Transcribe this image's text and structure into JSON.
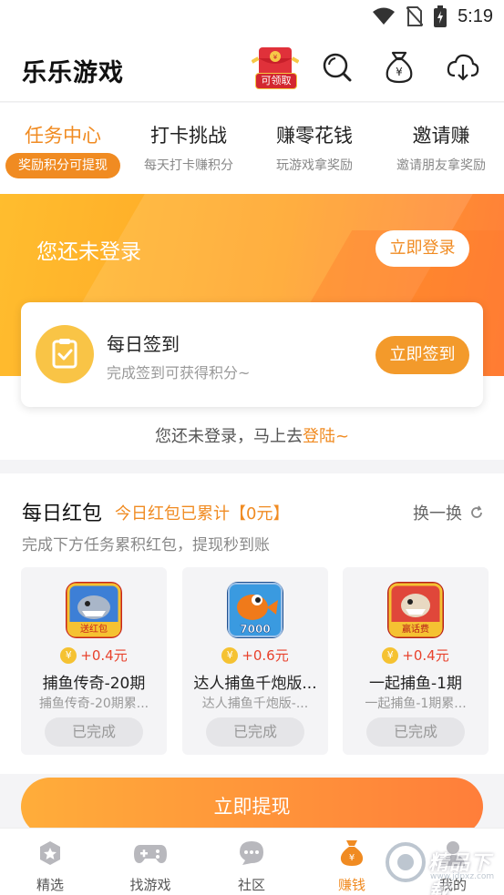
{
  "status_bar": {
    "time": "5:19"
  },
  "header": {
    "title": "乐乐游戏",
    "redpack_label": "可领取"
  },
  "tabs": [
    {
      "title": "任务中心",
      "subtitle": "奖励积分可提现",
      "active": true
    },
    {
      "title": "打卡挑战",
      "subtitle": "每天打卡赚积分",
      "active": false
    },
    {
      "title": "赚零花钱",
      "subtitle": "玩游戏拿奖励",
      "active": false
    },
    {
      "title": "邀请赚",
      "subtitle": "邀请朋友拿奖励",
      "active": false
    }
  ],
  "hero": {
    "not_logged_in": "您还未登录",
    "login_button": "立即登录",
    "sign_card": {
      "title": "每日签到",
      "subtitle": "完成签到可获得积分~",
      "button": "立即签到"
    },
    "notice_prefix": "您还未登录，马上去",
    "notice_link": "登陆~"
  },
  "daily": {
    "title": "每日红包",
    "total": "今日红包已累计【0元】",
    "swap": "换一换",
    "subtitle": "完成下方任务累积红包，提现秒到账",
    "cards": [
      {
        "reward": "+0.4元",
        "name": "捕鱼传奇-20期",
        "desc": "捕鱼传奇-20期累...",
        "status": "已完成",
        "icon_text": "送红包"
      },
      {
        "reward": "+0.6元",
        "name": "达人捕鱼千炮版...",
        "desc": "达人捕鱼千炮版-...",
        "status": "已完成",
        "icon_text": "7000"
      },
      {
        "reward": "+0.4元",
        "name": "一起捕鱼-1期",
        "desc": "一起捕鱼-1期累...",
        "status": "已完成",
        "icon_text": "赢话费"
      }
    ],
    "coin_symbol": "¥"
  },
  "withdraw_button": "立即提现",
  "bottom_nav": [
    {
      "label": "精选",
      "icon": "star-icon"
    },
    {
      "label": "找游戏",
      "icon": "gamepad-icon"
    },
    {
      "label": "社区",
      "icon": "chat-bubble-icon"
    },
    {
      "label": "赚钱",
      "icon": "money-bag-icon",
      "active": true
    },
    {
      "label": "我的",
      "icon": "profile-icon"
    }
  ],
  "watermark": {
    "text": "精品下载",
    "sub": "www.jdpxz.com"
  },
  "colors": {
    "accent": "#f08b22",
    "reward": "#e8412c",
    "coin": "#f5c232"
  }
}
